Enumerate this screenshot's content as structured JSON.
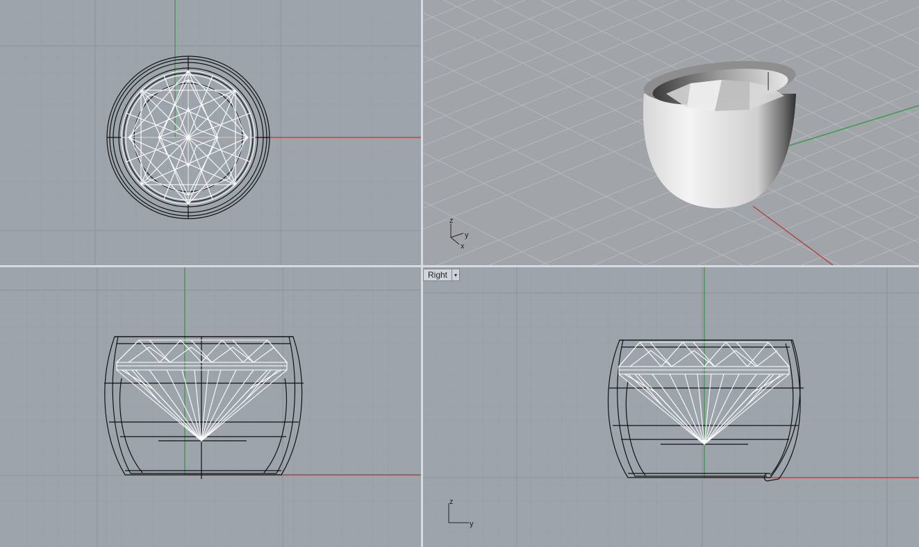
{
  "viewports": {
    "right": {
      "title": "Right"
    }
  },
  "axis_icons": {
    "perspective": {
      "z": "z",
      "y": "y",
      "x": "x"
    },
    "right": {
      "z": "z",
      "y": "y"
    }
  },
  "icons": {
    "dropdown": "▾"
  },
  "colors": {
    "grid_minor": "#97a0a8",
    "grid_major": "#8a939b",
    "x_axis": "#b33b35",
    "y_axis": "#2c9b3a",
    "wire_gem": "#ffffff",
    "wire_ring": "#111111"
  }
}
